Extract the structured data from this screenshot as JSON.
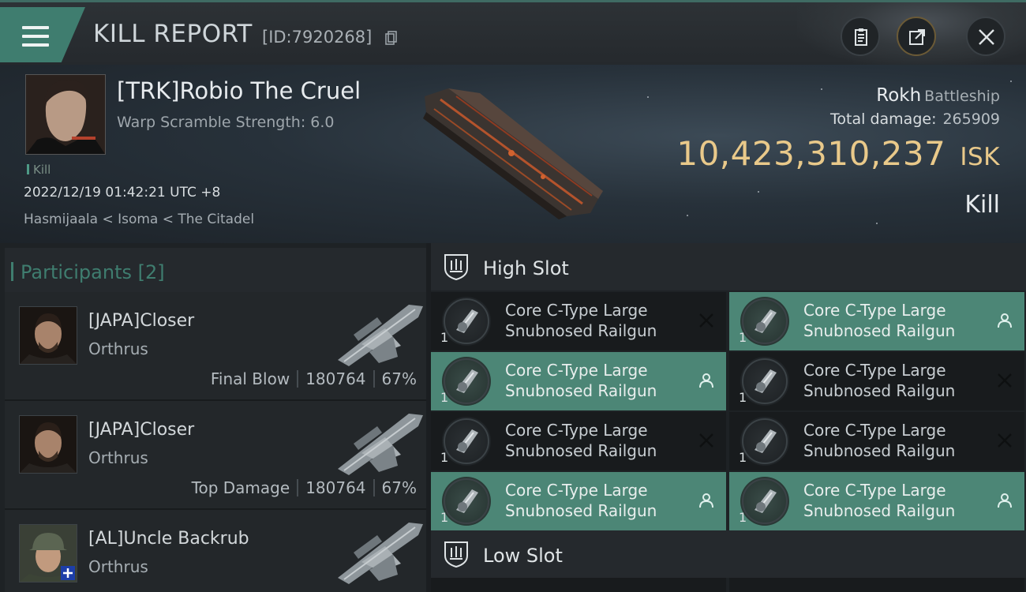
{
  "header": {
    "title": "KILL REPORT",
    "report_id": "[ID:7920268]"
  },
  "victim": {
    "name": "[TRK]Robio The Cruel",
    "warp_scramble": "Warp Scramble Strength: 6.0",
    "tag": "Kill",
    "datetime": "2022/12/19 01:42:21 UTC +8",
    "location": "Hasmijaala < Isoma < The Citadel",
    "ship": "Rokh",
    "ship_class": "Battleship",
    "total_damage_label": "Total damage:",
    "total_damage": "265909",
    "isk_value": "10,423,310,237",
    "isk_unit": "ISK",
    "result": "Kill"
  },
  "participants": {
    "title": "Participants",
    "count": "[2]",
    "items": [
      {
        "name": "[JAPA]Closer",
        "ship": "Orthrus",
        "role": "Final Blow",
        "damage": "180764",
        "percent": "67%"
      },
      {
        "name": "[JAPA]Closer",
        "ship": "Orthrus",
        "role": "Top Damage",
        "damage": "180764",
        "percent": "67%"
      },
      {
        "name": "[AL]Uncle Backrub",
        "ship": "Orthrus"
      }
    ]
  },
  "slots": {
    "high_title": "High Slot",
    "low_title": "Low Slot",
    "high_modules": [
      {
        "name": "Core C-Type Large Snubnosed Railgun",
        "qty": "1",
        "status": "destroyed"
      },
      {
        "name": "Core C-Type Large Snubnosed Railgun",
        "qty": "1",
        "status": "dropped"
      },
      {
        "name": "Core C-Type Large Snubnosed Railgun",
        "qty": "1",
        "status": "dropped"
      },
      {
        "name": "Core C-Type Large Snubnosed Railgun",
        "qty": "1",
        "status": "destroyed"
      },
      {
        "name": "Core C-Type Large Snubnosed Railgun",
        "qty": "1",
        "status": "destroyed"
      },
      {
        "name": "Core C-Type Large Snubnosed Railgun",
        "qty": "1",
        "status": "destroyed"
      },
      {
        "name": "Core C-Type Large Snubnosed Railgun",
        "qty": "1",
        "status": "dropped"
      },
      {
        "name": "Core C-Type Large Snubnosed Railgun",
        "qty": "1",
        "status": "dropped"
      }
    ]
  },
  "icons": {
    "menu": "menu-icon",
    "copy": "copy-icon",
    "clipboard": "clipboard-icon",
    "share": "share-icon",
    "close": "close-icon",
    "slot": "slot-icon",
    "destroyed": "x-icon",
    "dropped": "person-icon"
  },
  "colors": {
    "accent": "#3f7d6f",
    "highlight_row": "#4c8676",
    "isk": "#e9c98a"
  }
}
